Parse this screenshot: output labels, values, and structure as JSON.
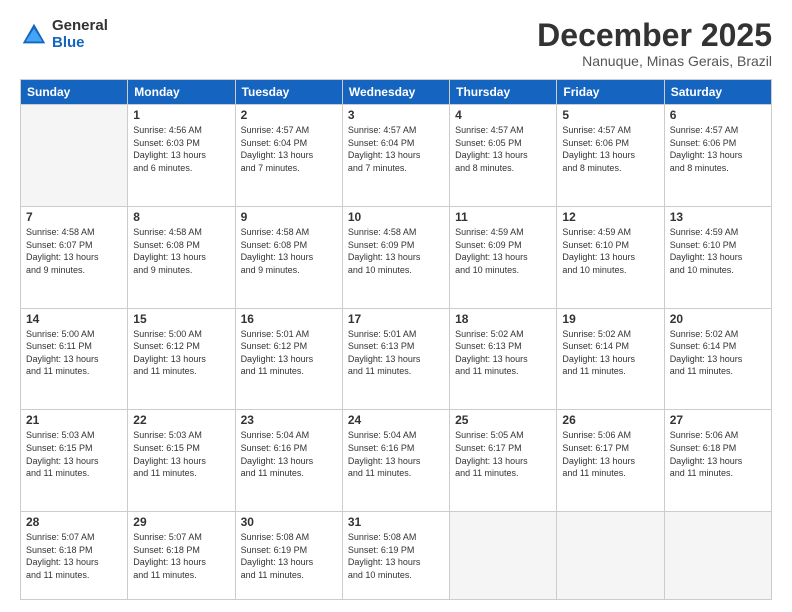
{
  "logo": {
    "general": "General",
    "blue": "Blue"
  },
  "title": "December 2025",
  "subtitle": "Nanuque, Minas Gerais, Brazil",
  "days_header": [
    "Sunday",
    "Monday",
    "Tuesday",
    "Wednesday",
    "Thursday",
    "Friday",
    "Saturday"
  ],
  "weeks": [
    [
      {
        "day": "",
        "info": ""
      },
      {
        "day": "1",
        "info": "Sunrise: 4:56 AM\nSunset: 6:03 PM\nDaylight: 13 hours\nand 6 minutes."
      },
      {
        "day": "2",
        "info": "Sunrise: 4:57 AM\nSunset: 6:04 PM\nDaylight: 13 hours\nand 7 minutes."
      },
      {
        "day": "3",
        "info": "Sunrise: 4:57 AM\nSunset: 6:04 PM\nDaylight: 13 hours\nand 7 minutes."
      },
      {
        "day": "4",
        "info": "Sunrise: 4:57 AM\nSunset: 6:05 PM\nDaylight: 13 hours\nand 8 minutes."
      },
      {
        "day": "5",
        "info": "Sunrise: 4:57 AM\nSunset: 6:06 PM\nDaylight: 13 hours\nand 8 minutes."
      },
      {
        "day": "6",
        "info": "Sunrise: 4:57 AM\nSunset: 6:06 PM\nDaylight: 13 hours\nand 8 minutes."
      }
    ],
    [
      {
        "day": "7",
        "info": "Sunrise: 4:58 AM\nSunset: 6:07 PM\nDaylight: 13 hours\nand 9 minutes."
      },
      {
        "day": "8",
        "info": "Sunrise: 4:58 AM\nSunset: 6:08 PM\nDaylight: 13 hours\nand 9 minutes."
      },
      {
        "day": "9",
        "info": "Sunrise: 4:58 AM\nSunset: 6:08 PM\nDaylight: 13 hours\nand 9 minutes."
      },
      {
        "day": "10",
        "info": "Sunrise: 4:58 AM\nSunset: 6:09 PM\nDaylight: 13 hours\nand 10 minutes."
      },
      {
        "day": "11",
        "info": "Sunrise: 4:59 AM\nSunset: 6:09 PM\nDaylight: 13 hours\nand 10 minutes."
      },
      {
        "day": "12",
        "info": "Sunrise: 4:59 AM\nSunset: 6:10 PM\nDaylight: 13 hours\nand 10 minutes."
      },
      {
        "day": "13",
        "info": "Sunrise: 4:59 AM\nSunset: 6:10 PM\nDaylight: 13 hours\nand 10 minutes."
      }
    ],
    [
      {
        "day": "14",
        "info": "Sunrise: 5:00 AM\nSunset: 6:11 PM\nDaylight: 13 hours\nand 11 minutes."
      },
      {
        "day": "15",
        "info": "Sunrise: 5:00 AM\nSunset: 6:12 PM\nDaylight: 13 hours\nand 11 minutes."
      },
      {
        "day": "16",
        "info": "Sunrise: 5:01 AM\nSunset: 6:12 PM\nDaylight: 13 hours\nand 11 minutes."
      },
      {
        "day": "17",
        "info": "Sunrise: 5:01 AM\nSunset: 6:13 PM\nDaylight: 13 hours\nand 11 minutes."
      },
      {
        "day": "18",
        "info": "Sunrise: 5:02 AM\nSunset: 6:13 PM\nDaylight: 13 hours\nand 11 minutes."
      },
      {
        "day": "19",
        "info": "Sunrise: 5:02 AM\nSunset: 6:14 PM\nDaylight: 13 hours\nand 11 minutes."
      },
      {
        "day": "20",
        "info": "Sunrise: 5:02 AM\nSunset: 6:14 PM\nDaylight: 13 hours\nand 11 minutes."
      }
    ],
    [
      {
        "day": "21",
        "info": "Sunrise: 5:03 AM\nSunset: 6:15 PM\nDaylight: 13 hours\nand 11 minutes."
      },
      {
        "day": "22",
        "info": "Sunrise: 5:03 AM\nSunset: 6:15 PM\nDaylight: 13 hours\nand 11 minutes."
      },
      {
        "day": "23",
        "info": "Sunrise: 5:04 AM\nSunset: 6:16 PM\nDaylight: 13 hours\nand 11 minutes."
      },
      {
        "day": "24",
        "info": "Sunrise: 5:04 AM\nSunset: 6:16 PM\nDaylight: 13 hours\nand 11 minutes."
      },
      {
        "day": "25",
        "info": "Sunrise: 5:05 AM\nSunset: 6:17 PM\nDaylight: 13 hours\nand 11 minutes."
      },
      {
        "day": "26",
        "info": "Sunrise: 5:06 AM\nSunset: 6:17 PM\nDaylight: 13 hours\nand 11 minutes."
      },
      {
        "day": "27",
        "info": "Sunrise: 5:06 AM\nSunset: 6:18 PM\nDaylight: 13 hours\nand 11 minutes."
      }
    ],
    [
      {
        "day": "28",
        "info": "Sunrise: 5:07 AM\nSunset: 6:18 PM\nDaylight: 13 hours\nand 11 minutes."
      },
      {
        "day": "29",
        "info": "Sunrise: 5:07 AM\nSunset: 6:18 PM\nDaylight: 13 hours\nand 11 minutes."
      },
      {
        "day": "30",
        "info": "Sunrise: 5:08 AM\nSunset: 6:19 PM\nDaylight: 13 hours\nand 11 minutes."
      },
      {
        "day": "31",
        "info": "Sunrise: 5:08 AM\nSunset: 6:19 PM\nDaylight: 13 hours\nand 10 minutes."
      },
      {
        "day": "",
        "info": ""
      },
      {
        "day": "",
        "info": ""
      },
      {
        "day": "",
        "info": ""
      }
    ]
  ]
}
